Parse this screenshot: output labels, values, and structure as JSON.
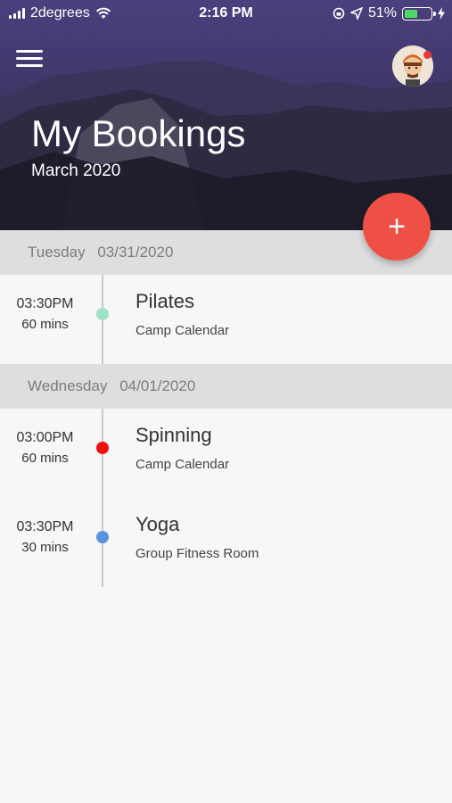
{
  "status_bar": {
    "carrier": "2degrees",
    "time": "2:16 PM",
    "battery": "51%",
    "battery_level": 0.51
  },
  "header": {
    "title": "My Bookings",
    "subtitle": "March 2020",
    "add_button_label": "+"
  },
  "colors": {
    "fab": "#ef5045",
    "header": "#453b72",
    "pilates_dot": "#9fe2c8",
    "spinning_dot": "#ee1111",
    "yoga_dot": "#5a93df"
  },
  "days": [
    {
      "weekday": "Tuesday",
      "date": "03/31/2020",
      "bookings": [
        {
          "time": "03:30PM",
          "duration": "60 mins",
          "name": "Pilates",
          "location": "Camp Calendar",
          "dot_color": "#9fe2c8"
        }
      ]
    },
    {
      "weekday": "Wednesday",
      "date": "04/01/2020",
      "bookings": [
        {
          "time": "03:00PM",
          "duration": "60 mins",
          "name": "Spinning",
          "location": "Camp Calendar",
          "dot_color": "#ee1111"
        },
        {
          "time": "03:30PM",
          "duration": "30 mins",
          "name": "Yoga",
          "location": "Group Fitness Room",
          "dot_color": "#5a93df"
        }
      ]
    }
  ]
}
